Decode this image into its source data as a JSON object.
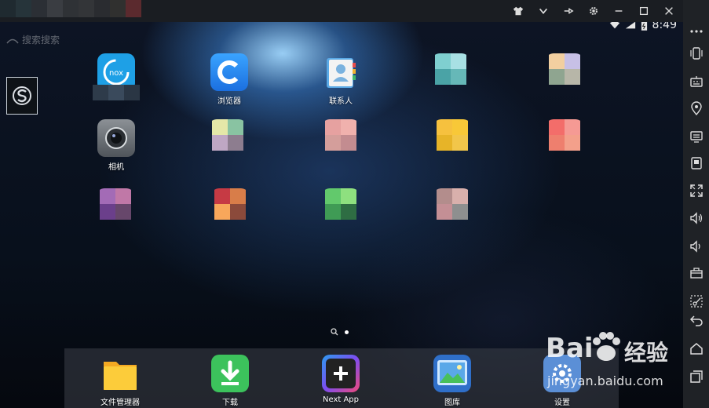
{
  "status": {
    "time": "8:49"
  },
  "top_left_faded": "搜索搜索",
  "apps": [
    {
      "label": "",
      "type": "nox"
    },
    {
      "label": "浏览器",
      "type": "browser"
    },
    {
      "label": "联系人",
      "type": "contacts"
    },
    {
      "label": "",
      "type": "pixel",
      "colors": [
        "#7fcfd0",
        "#a8e0e4",
        "#4aa3a6",
        "#66b8b8"
      ]
    },
    {
      "label": "",
      "type": "pixel",
      "colors": [
        "#f2cfa0",
        "#c7c0e6",
        "#8fa590",
        "#b7b6a8"
      ]
    },
    {
      "label": "相机",
      "type": "camera"
    },
    {
      "label": "",
      "type": "pixel",
      "colors": [
        "#e4e7a8",
        "#89c3a2",
        "#bfa7c4",
        "#8d7d8f"
      ]
    },
    {
      "label": "",
      "type": "pixel",
      "colors": [
        "#e6a1a0",
        "#f0b1ad",
        "#d49e9b",
        "#c38c90"
      ]
    },
    {
      "label": "",
      "type": "pixel",
      "colors": [
        "#f6c13e",
        "#f8c838",
        "#e7b428",
        "#f2c64a"
      ]
    },
    {
      "label": "",
      "type": "pixel",
      "colors": [
        "#f36d6a",
        "#f59a94",
        "#ee7f6e",
        "#f3a08b"
      ]
    },
    {
      "label": "",
      "type": "pixel",
      "colors": [
        "#a36bb6",
        "#c078a7",
        "#6b3f8b",
        "#67476b"
      ]
    },
    {
      "label": "",
      "type": "pixel",
      "colors": [
        "#c63a44",
        "#d87d49",
        "#f8a75b",
        "#8b4a3b"
      ]
    },
    {
      "label": "",
      "type": "pixel",
      "colors": [
        "#62c96c",
        "#8ee07f",
        "#3f9b55",
        "#2e6d43"
      ]
    },
    {
      "label": "",
      "type": "pixel",
      "colors": [
        "#b38d8c",
        "#d9b0ac",
        "#c48f95",
        "#8e8f8f"
      ]
    }
  ],
  "dock": [
    {
      "label": "文件管理器",
      "type": "files"
    },
    {
      "label": "下载",
      "type": "download"
    },
    {
      "label": "Next App",
      "type": "nextapp"
    },
    {
      "label": "图库",
      "type": "gallery"
    },
    {
      "label": "设置",
      "type": "settings"
    }
  ],
  "titlebar_icons": [
    "shirt-icon",
    "chevron-down-icon",
    "pin-icon",
    "gear-icon",
    "minimize-icon",
    "maximize-icon",
    "close-icon"
  ],
  "sidebar_icons": [
    "more-icon",
    "phone-rotate-icon",
    "keyboard-icon",
    "location-icon",
    "screen-icon",
    "screenshot-icon",
    "fullscreen-icon",
    "volume-up-icon",
    "volume-down-icon",
    "toolbox-icon",
    "scissors-icon",
    "back-icon",
    "home-icon",
    "recent-apps-icon"
  ],
  "watermark": {
    "brand_left": "Bai",
    "brand_right": "经验",
    "url": "jingyan.baidu.com"
  },
  "colors": {
    "accent": "#1ea0e6",
    "titlebar": "#1a1d22",
    "sidebar": "#1f2226"
  }
}
